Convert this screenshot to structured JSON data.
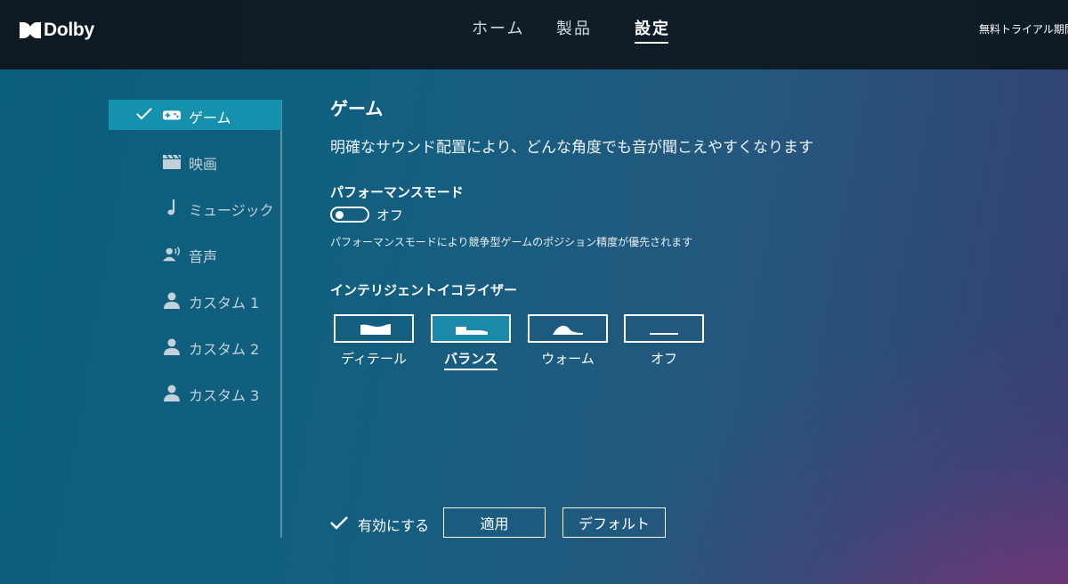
{
  "header": {
    "brand": "Dolby",
    "nav": [
      "ホーム",
      "製品",
      "設定"
    ],
    "nav_active": "設定",
    "trial_text": "無料トライアル期間は…"
  },
  "sidebar": {
    "items": [
      {
        "label": "ゲーム",
        "icon": "gamepad-icon",
        "selected": true
      },
      {
        "label": "映画",
        "icon": "clapperboard-icon"
      },
      {
        "label": "ミュージック",
        "icon": "music-note-icon"
      },
      {
        "label": "音声",
        "icon": "voice-person-icon"
      },
      {
        "label": "カスタム 1",
        "icon": "person-icon"
      },
      {
        "label": "カスタム 2",
        "icon": "person-icon"
      },
      {
        "label": "カスタム 3",
        "icon": "person-icon"
      }
    ]
  },
  "main": {
    "title": "ゲーム",
    "description": "明確なサウンド配置により、どんな角度でも音が聞こえやすくなります",
    "performance": {
      "title": "パフォーマンスモード",
      "state": "オフ",
      "note": "パフォーマンスモードにより競争型ゲームのポジション精度が優先されます"
    },
    "equalizer": {
      "title": "インテリジェントイコライザー",
      "options": [
        "ディテール",
        "バランス",
        "ウォーム",
        "オフ"
      ],
      "selected": "バランス"
    },
    "actions": {
      "enable_label": "有効にする",
      "apply_label": "適用",
      "default_label": "デフォルト"
    }
  },
  "colors": {
    "accent": "#1590ad",
    "header_bg": "#111d26",
    "bg_start": "#0b5e7c",
    "bg_end": "#353f72"
  }
}
